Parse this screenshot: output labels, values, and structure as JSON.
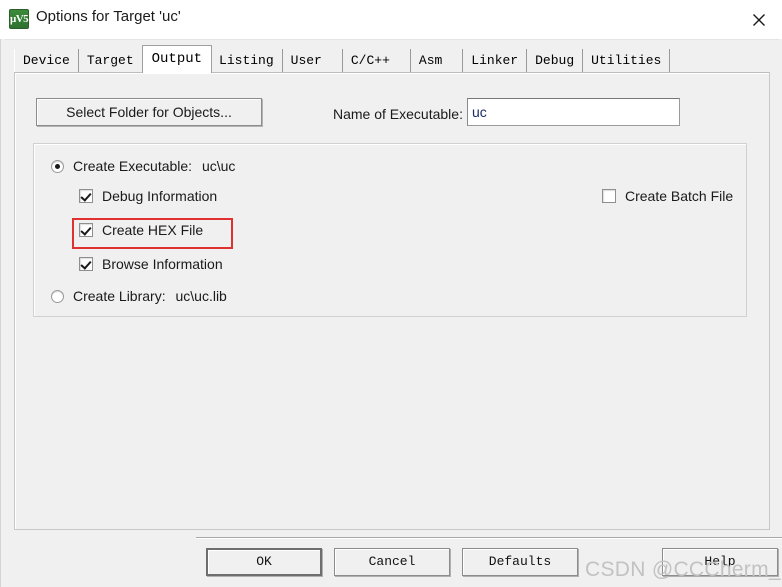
{
  "window": {
    "title": "Options for Target 'uc'",
    "icon_name": "keil-uvision-icon",
    "icon_glyph": "μV5",
    "close_icon": "close-icon"
  },
  "tabs": [
    {
      "label": "Device",
      "selected": false
    },
    {
      "label": "Target",
      "selected": false
    },
    {
      "label": "Output",
      "selected": true
    },
    {
      "label": "Listing",
      "selected": false
    },
    {
      "label": "User",
      "selected": false
    },
    {
      "label": "C/C++",
      "selected": false
    },
    {
      "label": "Asm",
      "selected": false
    },
    {
      "label": "Linker",
      "selected": false
    },
    {
      "label": "Debug",
      "selected": false
    },
    {
      "label": "Utilities",
      "selected": false
    }
  ],
  "output_page": {
    "select_folder_button": "Select Folder for Objects...",
    "executable_label": "Name of Executable:",
    "executable_value": "uc",
    "executable_placeholder": "",
    "create_executable": {
      "label": "Create Executable:",
      "path": "uc\\uc",
      "selected": true
    },
    "create_library": {
      "label": "Create Library:",
      "path": "uc\\uc.lib",
      "selected": false
    },
    "checkboxes": [
      {
        "label": "Debug Information",
        "checked": true
      },
      {
        "label": "Create HEX File",
        "checked": true
      },
      {
        "label": "Browse Information",
        "checked": true
      }
    ],
    "create_batch_file": {
      "label": "Create Batch File",
      "checked": false
    },
    "highlight_color": "#e03030",
    "highlight_target": "Create HEX File"
  },
  "buttons": {
    "ok": "OK",
    "cancel": "Cancel",
    "defaults": "Defaults",
    "help": "Help"
  },
  "watermark": "CSDN @CCCherm_mi"
}
